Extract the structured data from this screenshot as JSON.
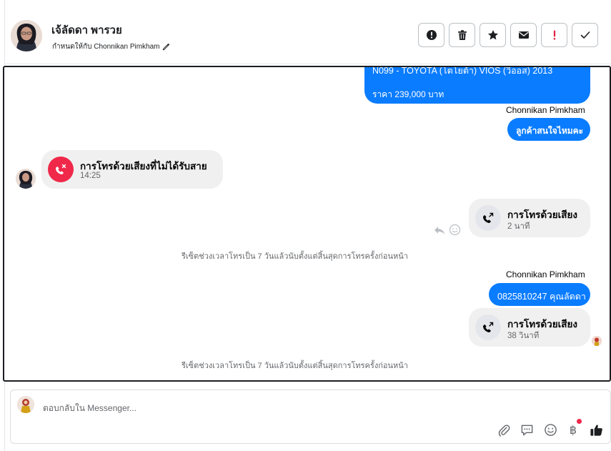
{
  "header": {
    "contact_name": "เจ้ลัดดา พารวย",
    "assigned_label": "กำหนดให้กับ Chonnikan Pimkham",
    "actions": [
      {
        "name": "spam-button",
        "icon": "alert-circle-icon"
      },
      {
        "name": "delete-button",
        "icon": "trash-icon"
      },
      {
        "name": "star-button",
        "icon": "star-icon"
      },
      {
        "name": "mark-unread-button",
        "icon": "envelope-icon"
      },
      {
        "name": "follow-up-button",
        "icon": "exclamation-icon"
      },
      {
        "name": "mark-done-button",
        "icon": "check-icon"
      }
    ]
  },
  "messages": {
    "product_line": "N099 - TOYOTA (โตโยต้า) VIOS (วีออส) 2013",
    "product_price": "ราคา 239,000 บาท",
    "sender_1": "Chonnikan Pimkham",
    "question": "ลูกค้าสนใจไหมคะ",
    "missed_call_title": "การโทรด้วยเสียงที่ไม่ได้รับสาย",
    "missed_call_time": "14:25",
    "outgoing_call_1_title": "การโทรด้วยเสียง",
    "outgoing_call_1_duration": "2 นาที",
    "notice_1": "รีเซ็ตช่วงเวลาโทรเป็น 7 วันแล้วนับตั้งแต่สิ้นสุดการโทรครั้งก่อนหน้า",
    "sender_2": "Chonnikan Pimkham",
    "phone_message": "0825810247 คุณลัดดา",
    "outgoing_call_2_title": "การโทรด้วยเสียง",
    "outgoing_call_2_duration": "38 วินาที",
    "notice_2": "รีเซ็ตช่วงเวลาโทรเป็น 7 วันแล้วนับตั้งแต่สิ้นสุดการโทรครั้งก่อนหน้า"
  },
  "composer": {
    "placeholder": "ตอบกลับใน Messenger...",
    "tools": [
      "paperclip-icon",
      "chat-bubble-icon",
      "smiley-icon",
      "baht-icon",
      "thumbs-up-icon"
    ],
    "baht_symbol": "฿"
  },
  "colors": {
    "accent_blue": "#0a7cff",
    "missed_call_red": "#f02849",
    "bubble_grey": "#f0f0f0",
    "notification_dot": "#f02849"
  }
}
